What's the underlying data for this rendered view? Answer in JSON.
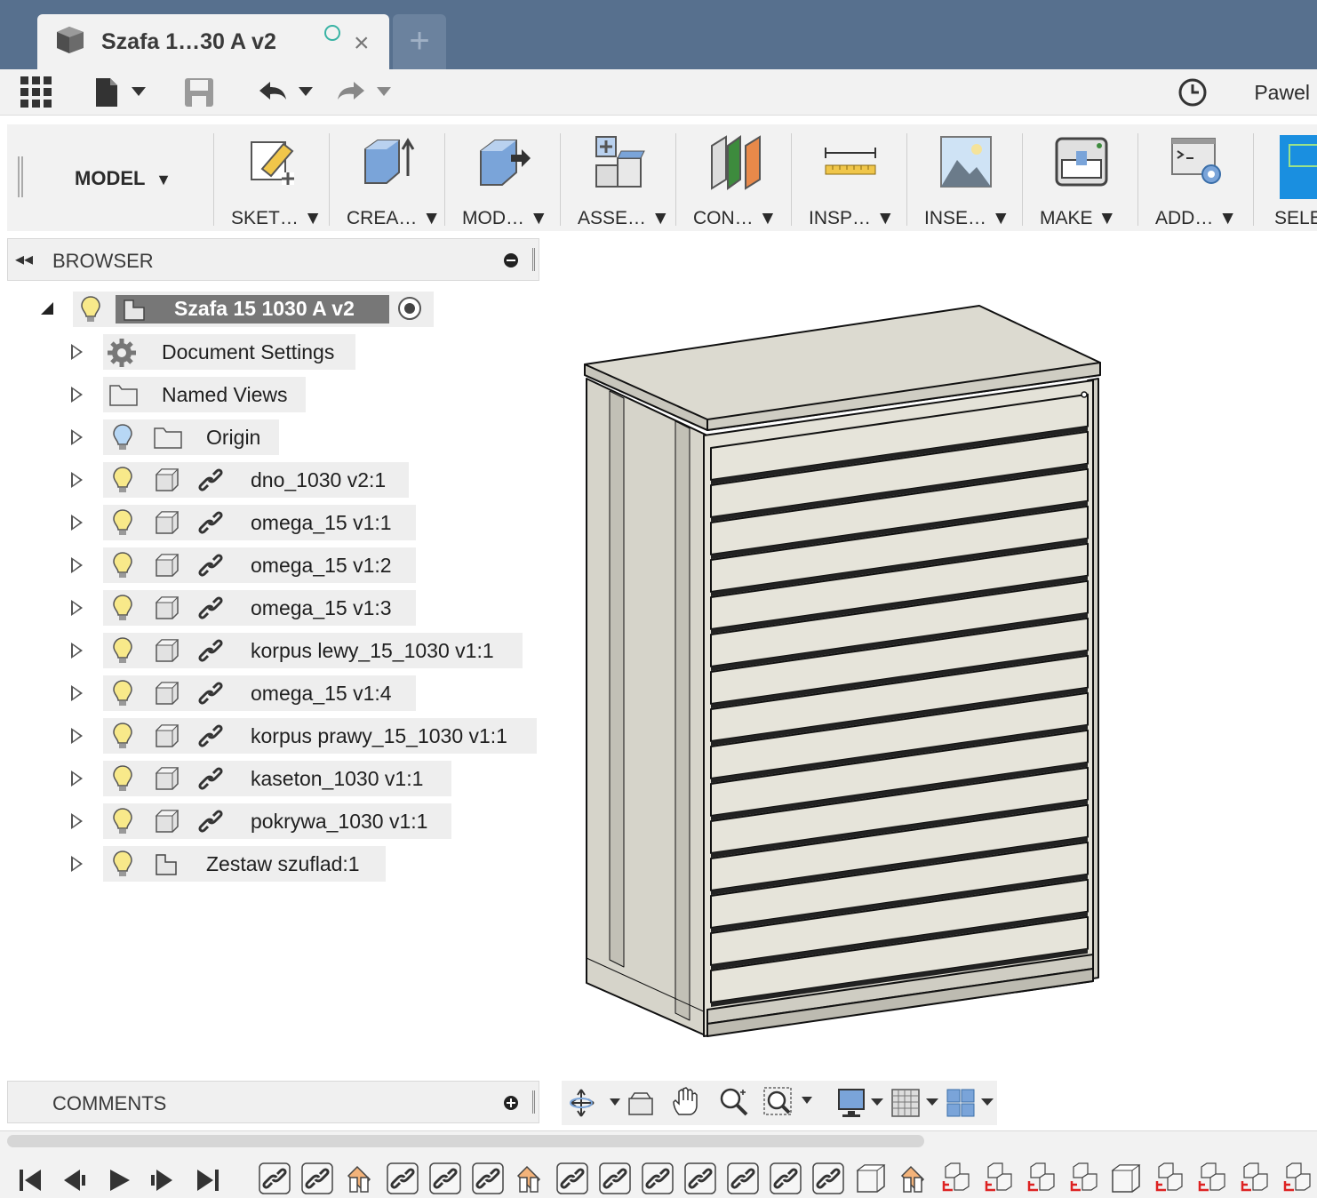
{
  "tab": {
    "title": "Szafa 1…30 A v2",
    "new_tab": "+",
    "close": "×"
  },
  "quick_access": {
    "user": "Pawel"
  },
  "ribbon": {
    "workspace": "MODEL",
    "groups": [
      {
        "label": "SKET…",
        "icon": "sketch-icon"
      },
      {
        "label": "CREA…",
        "icon": "create-icon"
      },
      {
        "label": "MOD…",
        "icon": "modify-icon"
      },
      {
        "label": "ASSE…",
        "icon": "assemble-icon"
      },
      {
        "label": "CON…",
        "icon": "construct-icon"
      },
      {
        "label": "INSP…",
        "icon": "inspect-icon"
      },
      {
        "label": "INSE…",
        "icon": "insert-icon"
      },
      {
        "label": "MAKE",
        "icon": "make-icon"
      },
      {
        "label": "ADD…",
        "icon": "addins-icon"
      },
      {
        "label": "SELE",
        "icon": "select-icon"
      }
    ]
  },
  "browser": {
    "title": "BROWSER",
    "root": {
      "label": "Szafa 15 1030 A v2"
    },
    "items": [
      {
        "label": "Document Settings",
        "type": "settings"
      },
      {
        "label": "Named Views",
        "type": "folder"
      },
      {
        "label": "Origin",
        "type": "origin"
      },
      {
        "label": "dno_1030 v2:1",
        "type": "link"
      },
      {
        "label": "omega_15 v1:1",
        "type": "link"
      },
      {
        "label": "omega_15 v1:2",
        "type": "link"
      },
      {
        "label": "omega_15 v1:3",
        "type": "link"
      },
      {
        "label": "korpus lewy_15_1030 v1:1",
        "type": "link"
      },
      {
        "label": "omega_15 v1:4",
        "type": "link"
      },
      {
        "label": "korpus prawy_15_1030 v1:1",
        "type": "link"
      },
      {
        "label": "kaseton_1030 v1:1",
        "type": "link"
      },
      {
        "label": "pokrywa_1030 v1:1",
        "type": "link"
      },
      {
        "label": "Zestaw szuflad:1",
        "type": "component"
      }
    ]
  },
  "comments": {
    "title": "COMMENTS"
  },
  "timeline": {
    "items": [
      "link",
      "link",
      "joint",
      "link",
      "link",
      "link",
      "joint",
      "link",
      "link",
      "link",
      "link",
      "link",
      "link",
      "link",
      "body",
      "joint",
      "comp",
      "comp",
      "comp",
      "comp",
      "body",
      "comp",
      "comp",
      "comp",
      "comp"
    ]
  }
}
